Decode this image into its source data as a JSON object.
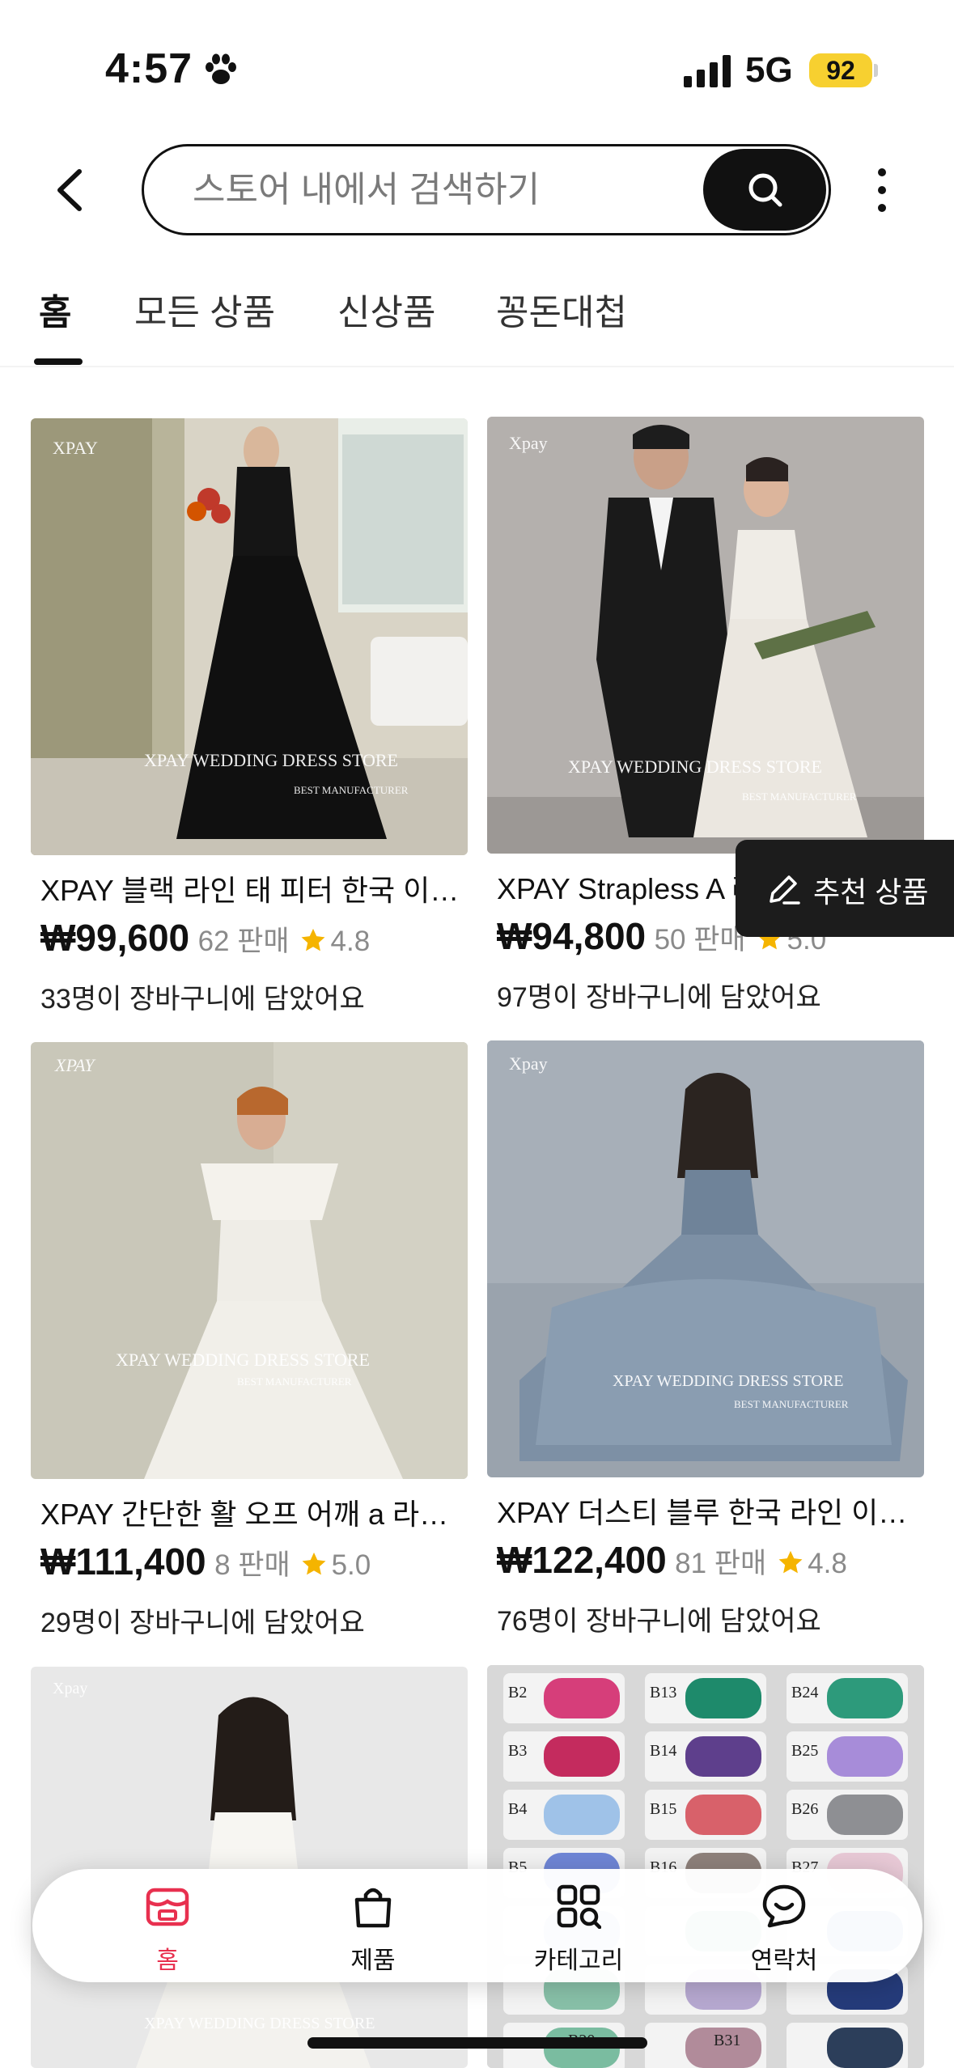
{
  "status_bar": {
    "time": "4:57",
    "network": "5G",
    "battery": "92",
    "battery_color": "#f7d030"
  },
  "header": {
    "back_icon": "chevron-left-icon",
    "search_placeholder": "스토어 내에서 검색하기",
    "search_icon": "search-icon",
    "more_icon": "more-vertical-icon"
  },
  "tabs": [
    {
      "label": "홈",
      "active": true
    },
    {
      "label": "모든 상품",
      "active": false
    },
    {
      "label": "신상품",
      "active": false
    },
    {
      "label": "꽁돈대첩",
      "active": false
    }
  ],
  "products": [
    {
      "title": "XPAY 블랙 라인 태 피터 한국 이…",
      "price": "₩99,600",
      "sold": "62 판매",
      "rating": "4.8",
      "cart_note": "33명이 장바구니에 담았어요",
      "wm_brand": "XPAY",
      "wm_store": "XPAY WEDDING DRESS STORE",
      "wm_maker": "BEST MANUFACTURER"
    },
    {
      "title": "XPAY Strapless A 라인 한국 이…",
      "price": "₩94,800",
      "sold": "50 판매",
      "rating": "5.0",
      "cart_note": "97명이 장바구니에 담았어요",
      "wm_brand": "Xpay",
      "wm_store": "XPAY WEDDING DRESS STORE",
      "wm_maker": "BEST MANUFACTURER"
    },
    {
      "title": "XPAY 간단한 활 오프 어깨 a 라…",
      "price": "₩111,400",
      "sold": "8 판매",
      "rating": "5.0",
      "cart_note": "29명이 장바구니에 담았어요",
      "wm_brand": "XPAY",
      "wm_store": "XPAY WEDDING DRESS STORE",
      "wm_maker": "BEST MANUFACTURER"
    },
    {
      "title": "XPAY 더스티 블루 한국 라인 이…",
      "price": "₩122,400",
      "sold": "81 판매",
      "rating": "4.8",
      "cart_note": "76명이 장바구니에 담았어요",
      "wm_brand": "Xpay",
      "wm_store": "XPAY WEDDING DRESS STORE",
      "wm_maker": "BEST MANUFACTURER"
    },
    {
      "wm_brand": "Xpay",
      "wm_store": "XPAY WEDDING DRESS STORE"
    },
    {
      "swatch_labels": [
        "B2",
        "B13",
        "B24",
        "B3",
        "B14",
        "B25",
        "B4",
        "B15",
        "B26",
        "B5",
        "B16",
        "B27",
        "B20",
        "B31"
      ]
    }
  ],
  "recommend": {
    "label": "추천 상품",
    "icon": "pencil-icon"
  },
  "bottom_nav": [
    {
      "label": "홈",
      "icon": "store-home-icon",
      "active": true
    },
    {
      "label": "제품",
      "icon": "shopping-bag-icon",
      "active": false
    },
    {
      "label": "카테고리",
      "icon": "category-grid-icon",
      "active": false
    },
    {
      "label": "연락처",
      "icon": "chat-smile-icon",
      "active": false
    }
  ],
  "colors": {
    "accent": "#e8304f",
    "star": "#f5b400",
    "dark": "#111111"
  }
}
